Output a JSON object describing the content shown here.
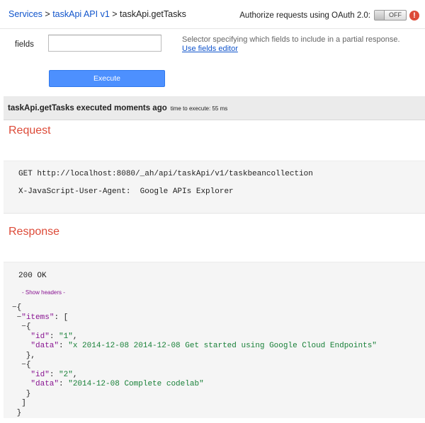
{
  "breadcrumb": {
    "services": "Services",
    "sep1": " > ",
    "api": "taskApi API v1",
    "sep2": " > ",
    "method": "taskApi.getTasks"
  },
  "oauth": {
    "label": "Authorize requests using OAuth 2.0:",
    "toggle": "OFF",
    "warning": "!"
  },
  "params": {
    "fields_label": "fields",
    "fields_value": "",
    "desc_line1": "Selector specifying which fields to include in a partial response.",
    "desc_link": "Use fields editor"
  },
  "execute_label": "Execute",
  "result": {
    "summary": "taskApi.getTasks executed moments ago",
    "time": "time to execute: 55 ms"
  },
  "request": {
    "title": "Request",
    "line1": "GET http://localhost:8080/_ah/api/taskApi/v1/taskbeancollection",
    "line2": "X-JavaScript-User-Agent:  Google APIs Explorer"
  },
  "response": {
    "title": "Response",
    "status": "200 OK",
    "show_headers": "- Show headers -",
    "items": [
      {
        "id": "1",
        "data": "x 2014-12-08 2014-12-08 Get started using Google Cloud Endpoints"
      },
      {
        "id": "2",
        "data": "2014-12-08 Complete codelab"
      }
    ]
  },
  "colors": {
    "accent": "#dd4b39",
    "link": "#1155cc",
    "button": "#4d90fe"
  }
}
